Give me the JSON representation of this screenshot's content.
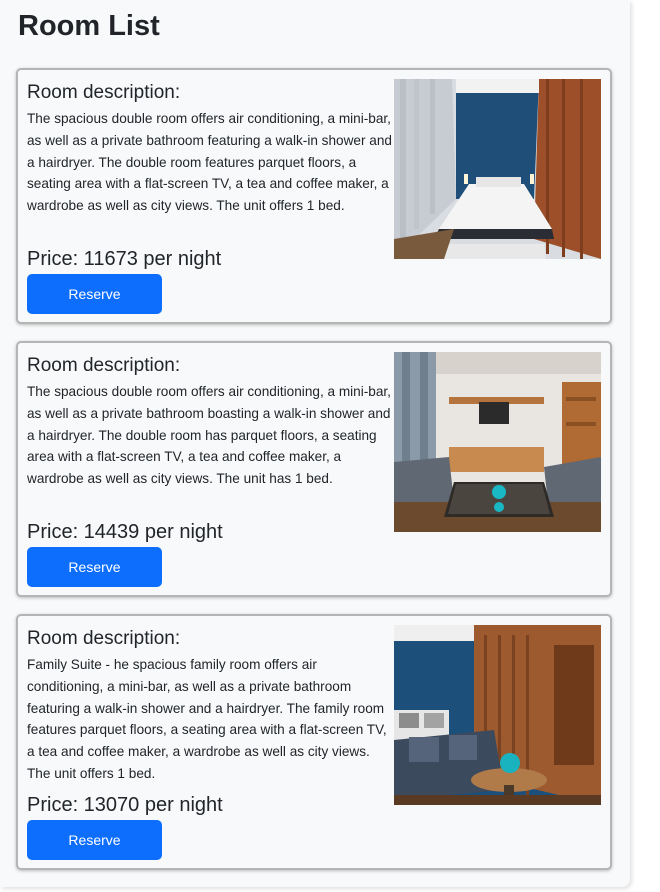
{
  "page": {
    "title": "Room List"
  },
  "rooms": [
    {
      "description_label": "Room description:",
      "description": "The spacious double room offers air conditioning, a mini-bar, as well as a private bathroom featuring a walk-in shower and a hairdryer. The double room features parquet floors, a seating area with a flat-screen TV, a tea and coffee maker, a wardrobe as well as city views. The unit offers 1 bed.",
      "price_text": "Price: 11673 per night",
      "price": 11673,
      "button_label": "Reserve",
      "photo": "hotel-bedroom-with-blue-wall-and-wood-panels"
    },
    {
      "description_label": "Room description:",
      "description": "The spacious double room offers air conditioning, a mini-bar, as well as a private bathroom boasting a walk-in shower and a hairdryer. The double room has parquet floors, a seating area with a flat-screen TV, a tea and coffee maker, a wardrobe as well as city views. The unit has 1 bed.",
      "price_text": "Price: 14439 per night",
      "price": 14439,
      "button_label": "Reserve",
      "photo": "hotel-living-area-with-sofas-and-tv"
    },
    {
      "description_label": "Room description:",
      "description": "Family Suite - he spacious family room offers air conditioning, a mini-bar, as well as a private bathroom featuring a walk-in shower and a hairdryer. The family room features parquet floors, a seating area with a flat-screen TV, a tea and coffee maker, a wardrobe as well as city views. The unit offers 1 bed.",
      "price_text": "Price: 13070 per night",
      "price": 13070,
      "button_label": "Reserve",
      "photo": "family-suite-with-armchair-and-wood-wall"
    }
  ],
  "colors": {
    "button": "#0d6efd",
    "button_text": "#ffffff",
    "background": "#f8f9fa"
  }
}
